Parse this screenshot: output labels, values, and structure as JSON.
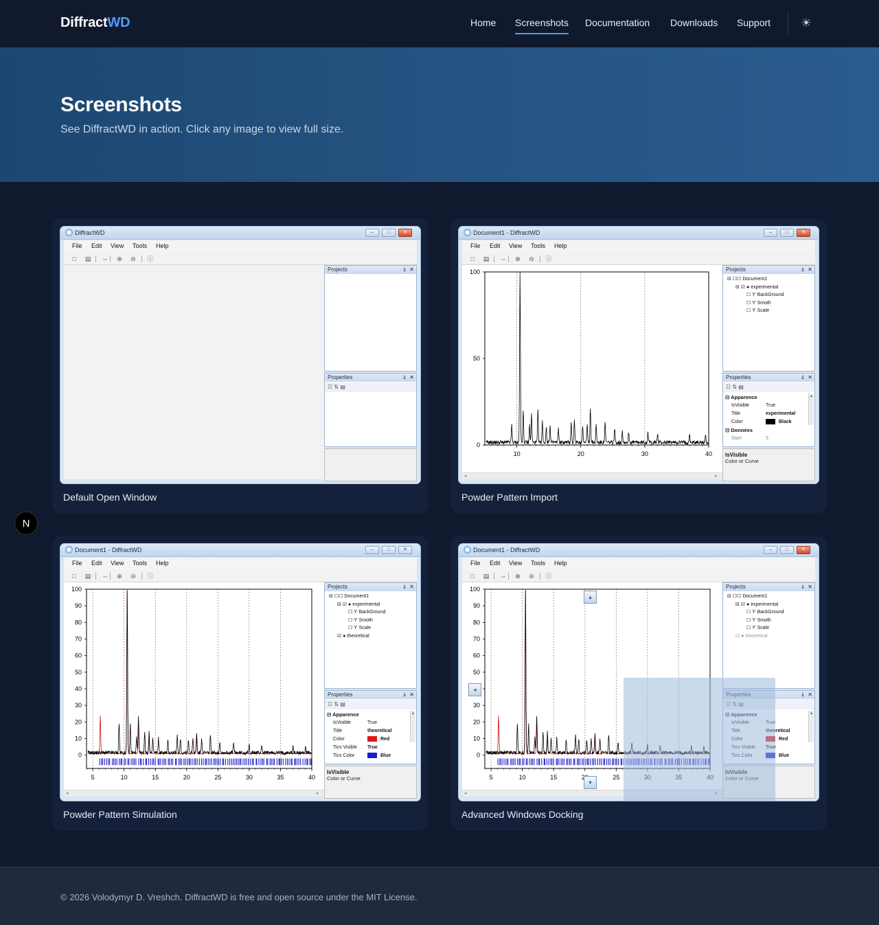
{
  "nav": {
    "brand_main": "Diffract",
    "brand_accent": "WD",
    "links": [
      "Home",
      "Screenshots",
      "Documentation",
      "Downloads",
      "Support"
    ],
    "active": "Screenshots",
    "theme_icon": "sun-icon"
  },
  "hero": {
    "title": "Screenshots",
    "subtitle": "See DiffractWD in action. Click any image to view full size."
  },
  "app": {
    "menu": [
      "File",
      "Edit",
      "View",
      "Tools",
      "Help"
    ],
    "pane_projects": "Projects",
    "pane_properties": "Properties",
    "pane_pin": "⫫",
    "pane_close": "✕",
    "desc_title": "IsVisible",
    "desc_text": "Color or Curve"
  },
  "screenshots": [
    {
      "caption": "Default Open Window",
      "window_title": "DiffractWD"
    },
    {
      "caption": "Powder Pattern Import",
      "window_title": "Document1 - DiffractWD",
      "tree": [
        "Document1",
        "experimental",
        "BackGround",
        "Smoth",
        "Scale"
      ],
      "props": {
        "cat1": "Apparence",
        "rows": [
          [
            "IsVisible",
            "True"
          ],
          [
            "Title",
            "experimental"
          ],
          [
            "Color",
            "Black"
          ]
        ],
        "cat2": "Données",
        "start_label": "Start",
        "start_value": "5"
      }
    },
    {
      "caption": "Powder Pattern Simulation",
      "window_title": "Document1 - DiffractWD",
      "tree": [
        "Document1",
        "experimental",
        "BackGround",
        "Smoth",
        "Scale",
        "theoretical"
      ],
      "props": {
        "cat1": "Apparence",
        "rows": [
          [
            "IsVisible",
            "True"
          ],
          [
            "Title",
            "theoretical"
          ],
          [
            "Color",
            "Red"
          ],
          [
            "Tics Visible",
            "True"
          ],
          [
            "Tics Color",
            "Blue"
          ]
        ]
      }
    },
    {
      "caption": "Advanced Windows Docking",
      "window_title": "Document1 - DiffractWD",
      "tree": [
        "Document1",
        "experimental",
        "BackGround",
        "Smoth",
        "Scale",
        "theoretical"
      ],
      "props": {
        "cat1": "Apparence",
        "rows": [
          [
            "IsVisible",
            "True"
          ],
          [
            "Title",
            "theoretical"
          ],
          [
            "Color",
            "Red"
          ],
          [
            "Tics Visible",
            "True"
          ],
          [
            "Tics Color",
            "Blue"
          ]
        ]
      }
    }
  ],
  "chart_data": [
    {
      "type": "line",
      "xlabel": "",
      "ylabel": "",
      "xlim": [
        5,
        40
      ],
      "ylim": [
        0,
        100
      ],
      "xticks": [
        10,
        20,
        30,
        40
      ],
      "yticks": [
        0,
        50,
        100
      ],
      "series": [
        {
          "color": "#000000",
          "peaks": [
            [
              9.2,
              10
            ],
            [
              10.5,
              98
            ],
            [
              11.0,
              18
            ],
            [
              12.0,
              10
            ],
            [
              12.3,
              16
            ],
            [
              13.3,
              18
            ],
            [
              14.0,
              12
            ],
            [
              14.6,
              9
            ],
            [
              15.2,
              10
            ],
            [
              16.5,
              8
            ],
            [
              18.5,
              12
            ],
            [
              19.0,
              13
            ],
            [
              20.3,
              10
            ],
            [
              21.0,
              10
            ],
            [
              21.5,
              20
            ],
            [
              22.4,
              10
            ],
            [
              23.8,
              11
            ],
            [
              25.3,
              8
            ],
            [
              26.5,
              7
            ],
            [
              27.5,
              6
            ],
            [
              30.5,
              6
            ],
            [
              32.0,
              5
            ],
            [
              37.0,
              5
            ],
            [
              39.5,
              4
            ]
          ],
          "baseline": 1.5
        }
      ]
    },
    {
      "type": "line",
      "xlabel": "",
      "ylabel": "",
      "xlim": [
        4,
        40
      ],
      "ylim": [
        -8,
        100
      ],
      "xticks": [
        5,
        10,
        15,
        20,
        25,
        30,
        35,
        40
      ],
      "yticks": [
        0,
        10,
        20,
        30,
        40,
        50,
        60,
        70,
        80,
        90,
        100
      ],
      "series": [
        {
          "name": "experimental",
          "color": "#000000",
          "peaks": [
            [
              9.2,
              18
            ],
            [
              10.5,
              98
            ],
            [
              11.0,
              17
            ],
            [
              12.0,
              9
            ],
            [
              12.3,
              21
            ],
            [
              13.3,
              13
            ],
            [
              14.0,
              12
            ],
            [
              14.6,
              8
            ],
            [
              15.5,
              9
            ],
            [
              17.0,
              7
            ],
            [
              18.5,
              10
            ],
            [
              19.0,
              9
            ],
            [
              20.3,
              8
            ],
            [
              21.0,
              9
            ],
            [
              21.6,
              12
            ],
            [
              22.4,
              9
            ],
            [
              23.8,
              10
            ],
            [
              25.3,
              7
            ],
            [
              27.5,
              6
            ],
            [
              30.0,
              5
            ],
            [
              32.0,
              5
            ],
            [
              37.0,
              4
            ],
            [
              39.0,
              4
            ]
          ],
          "baseline": 1.5
        },
        {
          "name": "theoretical",
          "color": "#d01010",
          "peaks": [
            [
              6.2,
              23
            ],
            [
              10.5,
              98
            ],
            [
              12.3,
              16
            ],
            [
              14.0,
              9
            ],
            [
              21.6,
              9
            ]
          ],
          "baseline": 1.0
        }
      ],
      "tics": {
        "color": "#2020c8"
      }
    },
    {
      "type": "line",
      "xlabel": "",
      "ylabel": "",
      "xlim": [
        4,
        40
      ],
      "ylim": [
        -8,
        100
      ],
      "xticks": [
        5,
        10,
        15,
        20,
        25,
        30,
        35,
        40
      ],
      "yticks": [
        0,
        10,
        20,
        30,
        40,
        50,
        60,
        70,
        80,
        90,
        100
      ],
      "series": [
        {
          "name": "experimental",
          "color": "#000000",
          "peaks": [
            [
              9.2,
              18
            ],
            [
              10.5,
              98
            ],
            [
              11.0,
              17
            ],
            [
              12.0,
              9
            ],
            [
              12.3,
              21
            ],
            [
              13.3,
              13
            ],
            [
              14.0,
              12
            ],
            [
              14.6,
              8
            ],
            [
              15.5,
              9
            ],
            [
              17.0,
              7
            ],
            [
              18.5,
              10
            ],
            [
              19.0,
              9
            ],
            [
              20.3,
              8
            ],
            [
              21.0,
              9
            ],
            [
              21.6,
              12
            ],
            [
              22.4,
              9
            ],
            [
              23.8,
              10
            ],
            [
              25.3,
              7
            ],
            [
              27.5,
              6
            ],
            [
              30.0,
              5
            ],
            [
              32.0,
              5
            ],
            [
              37.0,
              4
            ],
            [
              39.0,
              4
            ]
          ],
          "baseline": 1.5
        },
        {
          "name": "theoretical",
          "color": "#d01010",
          "peaks": [
            [
              6.2,
              23
            ],
            [
              10.5,
              98
            ],
            [
              12.3,
              16
            ],
            [
              14.0,
              9
            ],
            [
              21.6,
              9
            ]
          ],
          "baseline": 1.0
        }
      ],
      "tics": {
        "color": "#2020c8"
      }
    }
  ],
  "footer": {
    "text": "© 2026 Volodymyr D. Vreshch. DiffractWD is free and open source under the MIT License."
  }
}
